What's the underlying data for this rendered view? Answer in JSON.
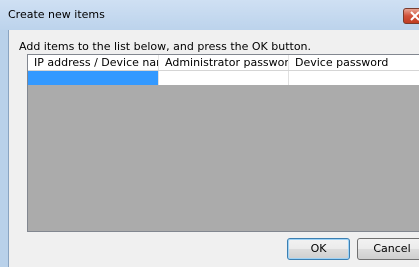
{
  "window": {
    "title": "Create new items"
  },
  "dialog": {
    "instruction": "Add items to the list below, and press the OK button."
  },
  "list": {
    "columns": [
      "IP address / Device name",
      "Administrator password",
      "Device password"
    ],
    "rows": [
      [
        "",
        "",
        ""
      ]
    ]
  },
  "buttons": {
    "ok_label": "OK",
    "cancel_label": "Cancel"
  },
  "colors": {
    "selection": "#3399ff",
    "list_background": "#ababab",
    "dialog_background": "#f0f0f0"
  }
}
